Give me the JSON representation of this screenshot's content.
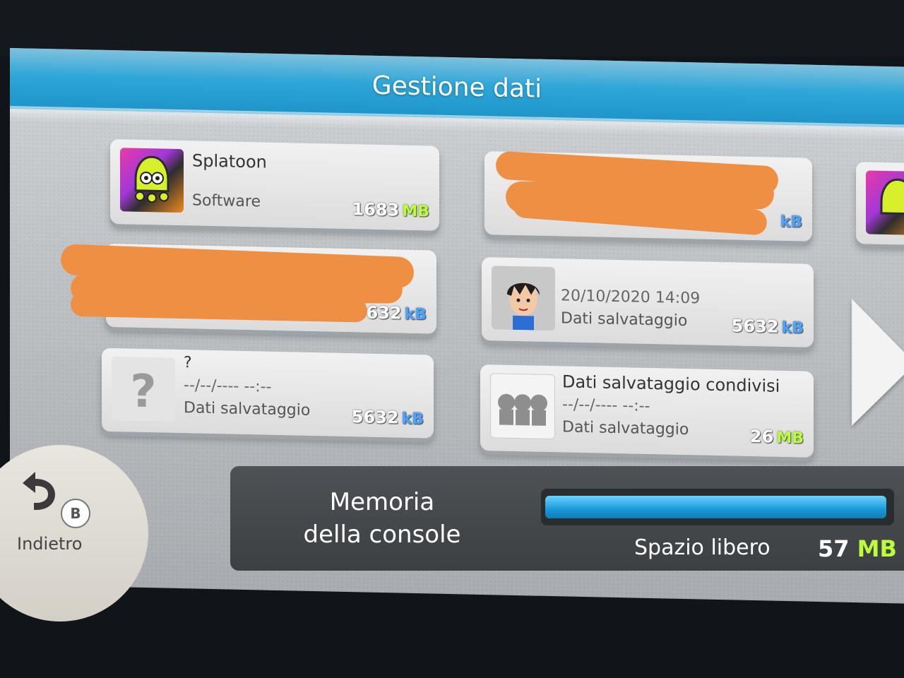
{
  "header": {
    "title": "Gestione dati"
  },
  "tiles": {
    "splatoon": {
      "title": "Splatoon",
      "sub": "Software",
      "size": "1683",
      "unit": "MB"
    },
    "redacted_top": {
      "unit": "kB"
    },
    "redacted_left": {
      "size_partial": "5632",
      "unit": "kB"
    },
    "mii_save": {
      "date": "20/10/2020 14:09",
      "sub": "Dati salvataggio",
      "size": "5632",
      "unit": "kB"
    },
    "unknown_save": {
      "title": "?",
      "date": "--/--/---- --:--",
      "sub": "Dati salvataggio",
      "size": "5632",
      "unit": "kB"
    },
    "shared_save": {
      "title": "Dati salvataggio condivisi",
      "date": "--/--/---- --:--",
      "sub": "Dati salvataggio",
      "size": "26",
      "unit": "MB"
    }
  },
  "back_button": {
    "label": "Indietro",
    "key": "B"
  },
  "memory": {
    "title_line1": "Memoria",
    "title_line2": "della console",
    "free_label": "Spazio libero",
    "free_value": "57",
    "free_unit": "MB",
    "used_fraction": 0.99
  },
  "colors": {
    "header": "#2ea6d8",
    "mb_unit": "#b9ff39",
    "kb_unit": "#4aa3ff",
    "bar": "#1a98d8",
    "redaction": "#ef8f43"
  }
}
